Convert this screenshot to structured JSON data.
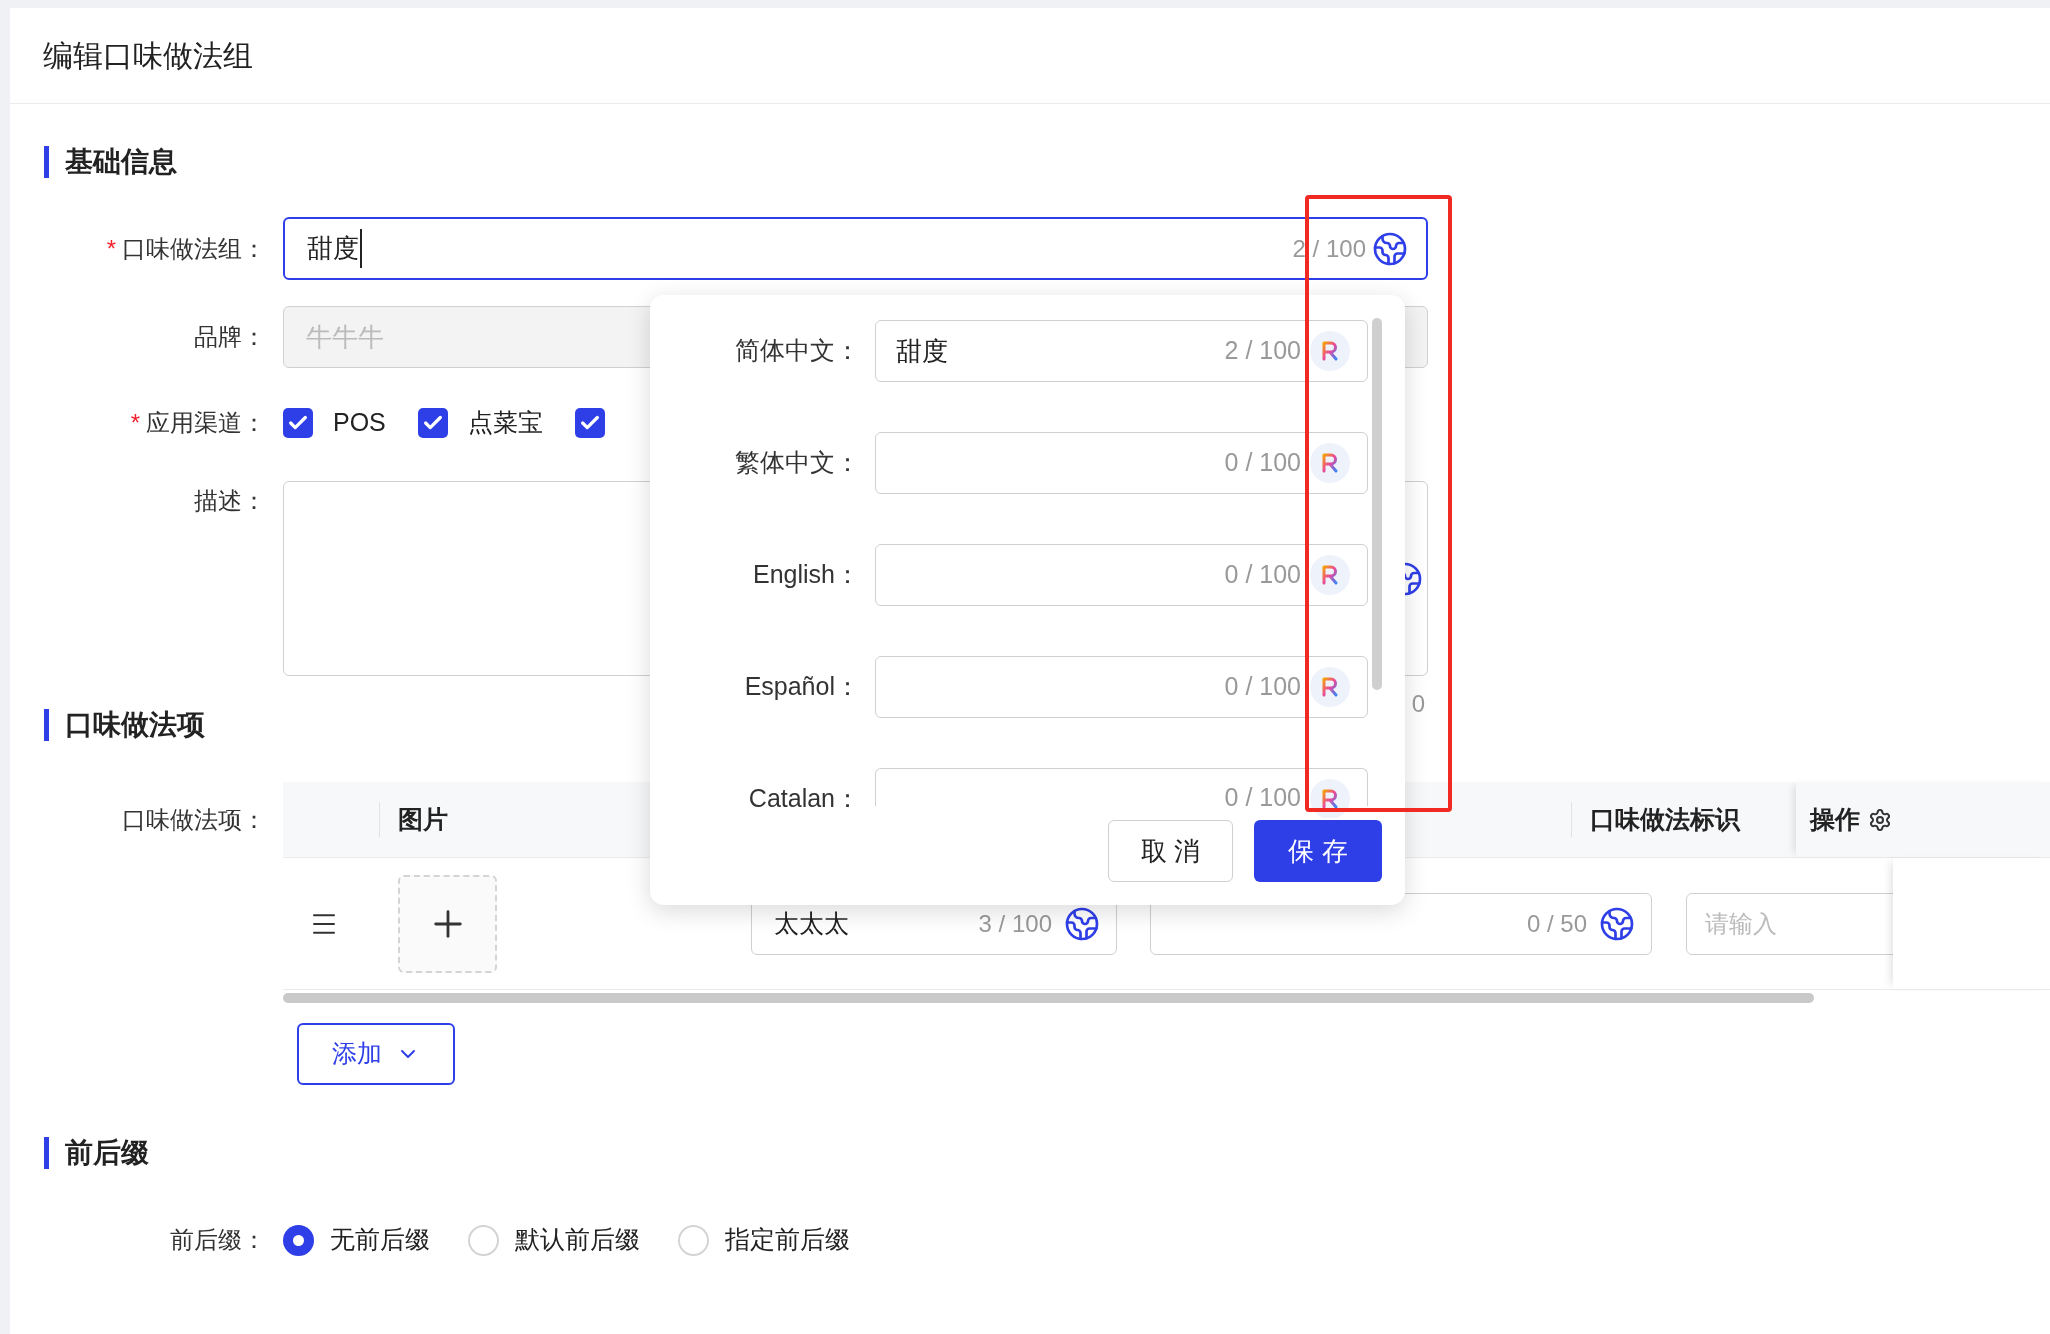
{
  "header": {
    "title": "编辑口味做法组"
  },
  "basic": {
    "title": "基础信息",
    "group_field": {
      "required_mark": "*",
      "label": "口味做法组：",
      "value": "甜度",
      "count": "2 / 100",
      "focused": true
    },
    "brand_field": {
      "label": "品牌：",
      "placeholder": "牛牛牛",
      "disabled": true
    },
    "channels": {
      "required_mark": "*",
      "label": "应用渠道：",
      "options": [
        {
          "label": "POS",
          "checked": true
        },
        {
          "label": "点菜宝",
          "checked": true
        },
        {
          "checked": true
        }
      ]
    },
    "description": {
      "label": "描述：",
      "count": "0"
    }
  },
  "items": {
    "title": "口味做法项",
    "label": "口味做法项：",
    "columns": [
      {
        "label": "图片"
      },
      {
        "label": "口味做法标识"
      },
      {
        "label": "操作"
      }
    ],
    "rows": [
      {
        "name": {
          "value": "太太太",
          "count": "3 / 100"
        },
        "code": {
          "count": "0 / 50"
        },
        "tag": {
          "placeholder": "请输入"
        }
      }
    ],
    "add_button": "添加"
  },
  "affix": {
    "title": "前后缀",
    "label": "前后缀：",
    "options": [
      {
        "label": "无前后缀",
        "selected": true
      },
      {
        "label": "默认前后缀",
        "selected": false
      },
      {
        "label": "指定前后缀",
        "selected": false
      }
    ]
  },
  "translation_popover": {
    "languages": [
      {
        "label": "简体中文：",
        "value": "甜度",
        "count": "2 / 100"
      },
      {
        "label": "繁体中文：",
        "count": "0 / 100"
      },
      {
        "label": "English：",
        "count": "0 / 100"
      },
      {
        "label": "Español：",
        "count": "0 / 100"
      },
      {
        "label": "Catalan：",
        "count": "0 / 100"
      }
    ],
    "buttons": [
      {
        "label": "取 消",
        "kind": "default"
      },
      {
        "label": "保 存",
        "kind": "primary"
      }
    ]
  }
}
